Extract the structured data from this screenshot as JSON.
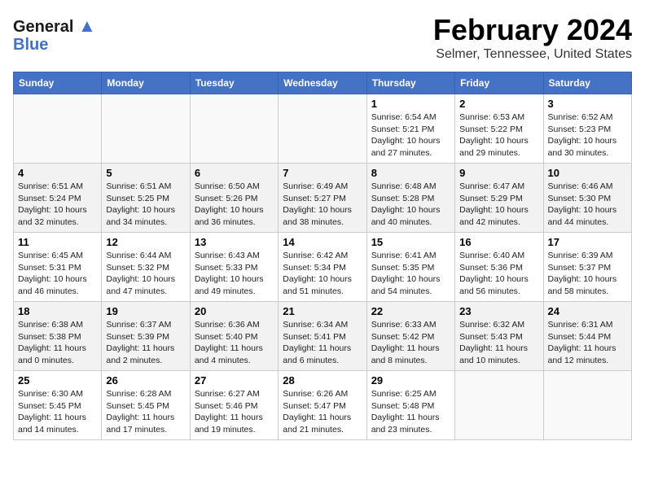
{
  "logo": {
    "line1": "General",
    "line2": "Blue"
  },
  "header": {
    "title": "February 2024",
    "subtitle": "Selmer, Tennessee, United States"
  },
  "days_of_week": [
    "Sunday",
    "Monday",
    "Tuesday",
    "Wednesday",
    "Thursday",
    "Friday",
    "Saturday"
  ],
  "weeks": [
    [
      {
        "day": "",
        "info": ""
      },
      {
        "day": "",
        "info": ""
      },
      {
        "day": "",
        "info": ""
      },
      {
        "day": "",
        "info": ""
      },
      {
        "day": "1",
        "info": "Sunrise: 6:54 AM\nSunset: 5:21 PM\nDaylight: 10 hours\nand 27 minutes."
      },
      {
        "day": "2",
        "info": "Sunrise: 6:53 AM\nSunset: 5:22 PM\nDaylight: 10 hours\nand 29 minutes."
      },
      {
        "day": "3",
        "info": "Sunrise: 6:52 AM\nSunset: 5:23 PM\nDaylight: 10 hours\nand 30 minutes."
      }
    ],
    [
      {
        "day": "4",
        "info": "Sunrise: 6:51 AM\nSunset: 5:24 PM\nDaylight: 10 hours\nand 32 minutes."
      },
      {
        "day": "5",
        "info": "Sunrise: 6:51 AM\nSunset: 5:25 PM\nDaylight: 10 hours\nand 34 minutes."
      },
      {
        "day": "6",
        "info": "Sunrise: 6:50 AM\nSunset: 5:26 PM\nDaylight: 10 hours\nand 36 minutes."
      },
      {
        "day": "7",
        "info": "Sunrise: 6:49 AM\nSunset: 5:27 PM\nDaylight: 10 hours\nand 38 minutes."
      },
      {
        "day": "8",
        "info": "Sunrise: 6:48 AM\nSunset: 5:28 PM\nDaylight: 10 hours\nand 40 minutes."
      },
      {
        "day": "9",
        "info": "Sunrise: 6:47 AM\nSunset: 5:29 PM\nDaylight: 10 hours\nand 42 minutes."
      },
      {
        "day": "10",
        "info": "Sunrise: 6:46 AM\nSunset: 5:30 PM\nDaylight: 10 hours\nand 44 minutes."
      }
    ],
    [
      {
        "day": "11",
        "info": "Sunrise: 6:45 AM\nSunset: 5:31 PM\nDaylight: 10 hours\nand 46 minutes."
      },
      {
        "day": "12",
        "info": "Sunrise: 6:44 AM\nSunset: 5:32 PM\nDaylight: 10 hours\nand 47 minutes."
      },
      {
        "day": "13",
        "info": "Sunrise: 6:43 AM\nSunset: 5:33 PM\nDaylight: 10 hours\nand 49 minutes."
      },
      {
        "day": "14",
        "info": "Sunrise: 6:42 AM\nSunset: 5:34 PM\nDaylight: 10 hours\nand 51 minutes."
      },
      {
        "day": "15",
        "info": "Sunrise: 6:41 AM\nSunset: 5:35 PM\nDaylight: 10 hours\nand 54 minutes."
      },
      {
        "day": "16",
        "info": "Sunrise: 6:40 AM\nSunset: 5:36 PM\nDaylight: 10 hours\nand 56 minutes."
      },
      {
        "day": "17",
        "info": "Sunrise: 6:39 AM\nSunset: 5:37 PM\nDaylight: 10 hours\nand 58 minutes."
      }
    ],
    [
      {
        "day": "18",
        "info": "Sunrise: 6:38 AM\nSunset: 5:38 PM\nDaylight: 11 hours\nand 0 minutes."
      },
      {
        "day": "19",
        "info": "Sunrise: 6:37 AM\nSunset: 5:39 PM\nDaylight: 11 hours\nand 2 minutes."
      },
      {
        "day": "20",
        "info": "Sunrise: 6:36 AM\nSunset: 5:40 PM\nDaylight: 11 hours\nand 4 minutes."
      },
      {
        "day": "21",
        "info": "Sunrise: 6:34 AM\nSunset: 5:41 PM\nDaylight: 11 hours\nand 6 minutes."
      },
      {
        "day": "22",
        "info": "Sunrise: 6:33 AM\nSunset: 5:42 PM\nDaylight: 11 hours\nand 8 minutes."
      },
      {
        "day": "23",
        "info": "Sunrise: 6:32 AM\nSunset: 5:43 PM\nDaylight: 11 hours\nand 10 minutes."
      },
      {
        "day": "24",
        "info": "Sunrise: 6:31 AM\nSunset: 5:44 PM\nDaylight: 11 hours\nand 12 minutes."
      }
    ],
    [
      {
        "day": "25",
        "info": "Sunrise: 6:30 AM\nSunset: 5:45 PM\nDaylight: 11 hours\nand 14 minutes."
      },
      {
        "day": "26",
        "info": "Sunrise: 6:28 AM\nSunset: 5:45 PM\nDaylight: 11 hours\nand 17 minutes."
      },
      {
        "day": "27",
        "info": "Sunrise: 6:27 AM\nSunset: 5:46 PM\nDaylight: 11 hours\nand 19 minutes."
      },
      {
        "day": "28",
        "info": "Sunrise: 6:26 AM\nSunset: 5:47 PM\nDaylight: 11 hours\nand 21 minutes."
      },
      {
        "day": "29",
        "info": "Sunrise: 6:25 AM\nSunset: 5:48 PM\nDaylight: 11 hours\nand 23 minutes."
      },
      {
        "day": "",
        "info": ""
      },
      {
        "day": "",
        "info": ""
      }
    ]
  ]
}
